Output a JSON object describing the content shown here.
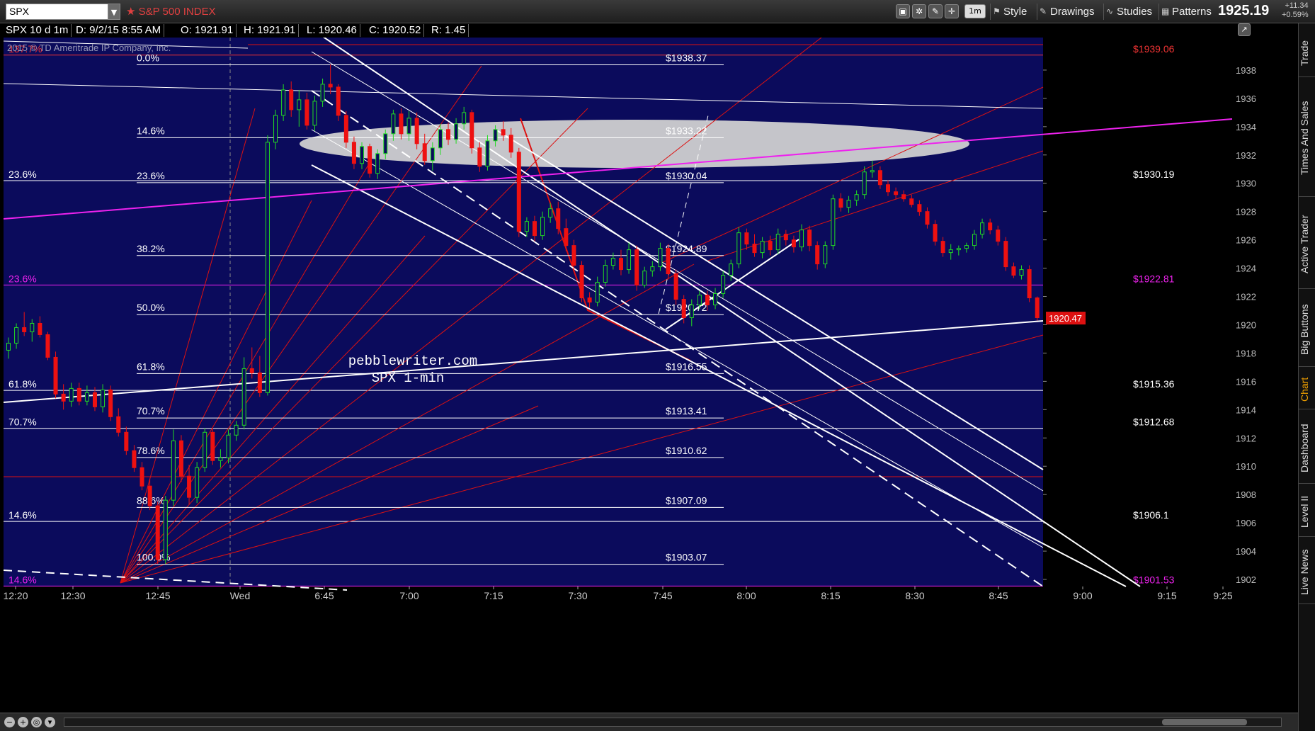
{
  "toolbar": {
    "symbol": "SPX",
    "symbol_name": "S&P 500 INDEX",
    "interval": "1m",
    "buttons": [
      "Style",
      "Drawings",
      "Studies",
      "Patterns"
    ],
    "last_price": "1925.19",
    "net_change": "+11.34",
    "pct_change": "+0.59%"
  },
  "infobar": {
    "cells": [
      "SPX 10 d 1m",
      "D: 9/2/15 8:55 AM",
      "O: 1921.91",
      "H: 1921.91",
      "L: 1920.46",
      "C: 1920.52",
      "R: 1.45"
    ],
    "copyright": "2015 © TD Ameritrade IP Company, Inc."
  },
  "sidebar": {
    "tabs": [
      "Trade",
      "Times And Sales",
      "Active Trader",
      "Big Buttons",
      "Chart",
      "Dashboard",
      "Level II",
      "Live News"
    ],
    "active_tab": "Chart"
  },
  "colors": {
    "background": "#0b0b5c",
    "up_candle": "#22dd22",
    "down_candle": "#ee1111",
    "fib_line": "#ffffff",
    "channel": "#ffffff",
    "magenta": "#ee22ee",
    "red_line": "#dd1111",
    "price_tag": "#dd1111"
  },
  "chart_data": {
    "type": "candlestick",
    "title": "SPX 1-min",
    "watermark": [
      "pebblewriter.com",
      "SPX 1-min"
    ],
    "ylim": [
      1901.5,
      1940.3
    ],
    "y_ticks": [
      1902,
      1904,
      1906,
      1908,
      1910,
      1912,
      1914,
      1916,
      1918,
      1920,
      1922,
      1924,
      1926,
      1928,
      1930,
      1932,
      1934,
      1936,
      1938
    ],
    "x_ticks": [
      "12:20",
      "12:30",
      "12:45",
      "Wed",
      "6:45",
      "7:00",
      "7:15",
      "7:30",
      "7:45",
      "8:00",
      "8:15",
      "8:30",
      "8:45",
      "9:00",
      "9:15",
      "9:25"
    ],
    "current_price_label": "1920.47",
    "fib_retracement": [
      {
        "pct": "0.0%",
        "price": "$1938.37",
        "value": 1938.37
      },
      {
        "pct": "14.6%",
        "price": "$1933.22",
        "value": 1933.22
      },
      {
        "pct": "23.6%",
        "price": "$1930.04",
        "value": 1930.04
      },
      {
        "pct": "38.2%",
        "price": "$1924.89",
        "value": 1924.89
      },
      {
        "pct": "50.0%",
        "price": "$1920.72",
        "value": 1920.72
      },
      {
        "pct": "61.8%",
        "price": "$1916.55",
        "value": 1916.55
      },
      {
        "pct": "70.7%",
        "price": "$1913.41",
        "value": 1913.41
      },
      {
        "pct": "78.6%",
        "price": "$1910.62",
        "value": 1910.62
      },
      {
        "pct": "88.6%",
        "price": "$1907.09",
        "value": 1907.09
      },
      {
        "pct": "100.0%",
        "price": "$1903.07",
        "value": 1903.07
      }
    ],
    "wide_fib_levels": [
      {
        "pct": "137.7%",
        "price": "$1939.06",
        "value": 1939.06,
        "color": "#ee3333"
      },
      {
        "pct": "23.6%",
        "price": "$1930.19",
        "value": 1930.19,
        "color": "#ffffff"
      },
      {
        "pct": "23.6%",
        "price": "$1922.81",
        "value": 1922.81,
        "color": "#ee22ee"
      },
      {
        "pct": "61.8%",
        "price": "$1915.36",
        "value": 1915.36,
        "color": "#ffffff"
      },
      {
        "pct": "70.7%",
        "price": "$1912.68",
        "value": 1912.68,
        "color": "#ffffff"
      },
      {
        "pct": "14.6%",
        "price": "$1906.1",
        "value": 1906.1,
        "color": "#ffffff"
      },
      {
        "pct": "14.6%",
        "price": "$1901.53",
        "value": 1901.53,
        "color": "#ee22ee"
      }
    ],
    "candles": [
      [
        1918.2,
        1919.1,
        1917.6,
        1918.7
      ],
      [
        1918.7,
        1920.1,
        1918.3,
        1919.8
      ],
      [
        1919.8,
        1920.9,
        1919.2,
        1919.5
      ],
      [
        1919.5,
        1920.4,
        1918.8,
        1920.1
      ],
      [
        1920.1,
        1920.6,
        1919.1,
        1919.3
      ],
      [
        1919.3,
        1919.5,
        1917.5,
        1917.7
      ],
      [
        1917.7,
        1918.1,
        1914.8,
        1915.1
      ],
      [
        1915.1,
        1915.8,
        1914.0,
        1914.6
      ],
      [
        1914.6,
        1915.9,
        1914.2,
        1915.5
      ],
      [
        1915.5,
        1915.9,
        1914.3,
        1914.6
      ],
      [
        1914.6,
        1915.7,
        1914.3,
        1915.2
      ],
      [
        1915.2,
        1915.6,
        1913.9,
        1914.2
      ],
      [
        1914.2,
        1915.8,
        1913.8,
        1915.4
      ],
      [
        1915.4,
        1915.7,
        1913.2,
        1913.5
      ],
      [
        1913.5,
        1914.1,
        1912.1,
        1912.4
      ],
      [
        1912.4,
        1912.8,
        1910.8,
        1911.1
      ],
      [
        1911.1,
        1911.5,
        1909.6,
        1909.9
      ],
      [
        1909.9,
        1910.3,
        1908.3,
        1908.6
      ],
      [
        1908.6,
        1909.1,
        1906.9,
        1907.2
      ],
      [
        1907.2,
        1907.5,
        1903.1,
        1903.4
      ],
      [
        1903.4,
        1907.9,
        1903.1,
        1907.6
      ],
      [
        1907.6,
        1912.6,
        1907.2,
        1911.8
      ],
      [
        1911.8,
        1912.2,
        1908.9,
        1909.3
      ],
      [
        1909.3,
        1910.1,
        1907.3,
        1907.8
      ],
      [
        1907.8,
        1910.3,
        1907.4,
        1909.9
      ],
      [
        1909.9,
        1912.7,
        1909.6,
        1912.4
      ],
      [
        1912.4,
        1912.7,
        1910.1,
        1910.4
      ],
      [
        1910.4,
        1911.2,
        1909.9,
        1910.6
      ],
      [
        1910.6,
        1912.6,
        1910.2,
        1912.2
      ],
      [
        1912.2,
        1913.2,
        1911.8,
        1912.9
      ],
      [
        1912.9,
        1917.7,
        1912.6,
        1916.9
      ],
      [
        1916.9,
        1918.4,
        1916.2,
        1916.6
      ],
      [
        1916.6,
        1917.8,
        1914.9,
        1915.2
      ],
      [
        1915.2,
        1933.4,
        1915.0,
        1932.9
      ],
      [
        1932.9,
        1935.2,
        1932.4,
        1934.8
      ],
      [
        1934.8,
        1937.0,
        1934.4,
        1936.6
      ],
      [
        1936.6,
        1937.2,
        1934.7,
        1935.2
      ],
      [
        1935.2,
        1936.6,
        1934.0,
        1935.9
      ],
      [
        1935.9,
        1936.4,
        1933.8,
        1934.1
      ],
      [
        1934.1,
        1936.2,
        1933.7,
        1935.8
      ],
      [
        1935.8,
        1937.4,
        1935.4,
        1937.0
      ],
      [
        1937.0,
        1938.4,
        1936.3,
        1936.8
      ],
      [
        1936.8,
        1937.0,
        1934.4,
        1934.8
      ],
      [
        1934.8,
        1935.1,
        1932.5,
        1932.9
      ],
      [
        1932.9,
        1933.3,
        1931.0,
        1931.4
      ],
      [
        1931.4,
        1932.9,
        1931.0,
        1932.6
      ],
      [
        1932.6,
        1932.8,
        1930.4,
        1930.7
      ],
      [
        1930.7,
        1932.4,
        1930.3,
        1932.1
      ],
      [
        1932.1,
        1933.8,
        1931.7,
        1933.5
      ],
      [
        1933.5,
        1935.2,
        1933.0,
        1934.9
      ],
      [
        1934.9,
        1935.3,
        1933.1,
        1933.5
      ],
      [
        1933.5,
        1935.1,
        1933.0,
        1934.6
      ],
      [
        1934.6,
        1935.0,
        1932.4,
        1932.8
      ],
      [
        1932.8,
        1933.5,
        1931.3,
        1931.6
      ],
      [
        1931.6,
        1932.9,
        1930.9,
        1932.5
      ],
      [
        1932.5,
        1934.2,
        1932.0,
        1933.8
      ],
      [
        1933.8,
        1934.3,
        1932.7,
        1933.1
      ],
      [
        1933.1,
        1934.6,
        1932.8,
        1934.2
      ],
      [
        1934.2,
        1935.4,
        1933.8,
        1935.0
      ],
      [
        1935.0,
        1935.2,
        1932.1,
        1932.5
      ],
      [
        1932.5,
        1932.9,
        1930.8,
        1931.2
      ],
      [
        1931.2,
        1933.4,
        1930.9,
        1933.0
      ],
      [
        1933.0,
        1934.1,
        1932.6,
        1933.8
      ],
      [
        1933.8,
        1934.4,
        1933.0,
        1933.4
      ],
      [
        1933.4,
        1933.9,
        1931.8,
        1932.2
      ],
      [
        1932.2,
        1932.5,
        1926.2,
        1926.6
      ],
      [
        1926.6,
        1927.6,
        1926.2,
        1927.3
      ],
      [
        1927.3,
        1927.7,
        1925.9,
        1926.3
      ],
      [
        1926.3,
        1928.0,
        1926.0,
        1927.6
      ],
      [
        1927.6,
        1928.6,
        1927.2,
        1928.2
      ],
      [
        1928.2,
        1928.7,
        1926.4,
        1926.8
      ],
      [
        1926.8,
        1927.5,
        1925.2,
        1925.6
      ],
      [
        1925.6,
        1926.0,
        1923.8,
        1924.2
      ],
      [
        1924.2,
        1924.5,
        1921.6,
        1921.9
      ],
      [
        1921.9,
        1922.3,
        1921.2,
        1921.6
      ],
      [
        1921.6,
        1923.4,
        1921.3,
        1923.0
      ],
      [
        1923.0,
        1924.6,
        1922.7,
        1924.2
      ],
      [
        1924.2,
        1925.1,
        1923.9,
        1924.7
      ],
      [
        1924.7,
        1925.3,
        1923.5,
        1923.9
      ],
      [
        1923.9,
        1925.8,
        1923.6,
        1925.3
      ],
      [
        1925.3,
        1925.6,
        1922.4,
        1922.8
      ],
      [
        1922.8,
        1924.1,
        1922.6,
        1923.8
      ],
      [
        1923.8,
        1924.5,
        1923.4,
        1924.1
      ],
      [
        1924.1,
        1925.8,
        1923.8,
        1925.4
      ],
      [
        1925.4,
        1925.7,
        1923.2,
        1923.6
      ],
      [
        1923.6,
        1923.9,
        1921.4,
        1921.8
      ],
      [
        1921.8,
        1922.1,
        1920.1,
        1920.5
      ],
      [
        1920.5,
        1921.8,
        1919.9,
        1921.4
      ],
      [
        1921.4,
        1922.4,
        1921.1,
        1922.1
      ],
      [
        1922.1,
        1922.4,
        1921.0,
        1921.4
      ],
      [
        1921.4,
        1922.6,
        1921.1,
        1922.2
      ],
      [
        1922.2,
        1923.8,
        1921.9,
        1923.5
      ],
      [
        1923.5,
        1924.6,
        1923.1,
        1924.3
      ],
      [
        1924.3,
        1926.9,
        1924.0,
        1926.5
      ],
      [
        1926.5,
        1926.8,
        1925.3,
        1925.7
      ],
      [
        1925.7,
        1926.4,
        1924.8,
        1925.1
      ],
      [
        1925.1,
        1926.2,
        1924.7,
        1925.9
      ],
      [
        1925.9,
        1926.3,
        1924.9,
        1925.3
      ],
      [
        1925.3,
        1926.8,
        1925.0,
        1926.4
      ],
      [
        1926.4,
        1926.7,
        1925.6,
        1926.0
      ],
      [
        1926.0,
        1926.3,
        1925.1,
        1925.5
      ],
      [
        1925.5,
        1927.1,
        1925.2,
        1926.7
      ],
      [
        1926.7,
        1927.0,
        1925.2,
        1925.6
      ],
      [
        1925.6,
        1925.9,
        1923.9,
        1924.3
      ],
      [
        1924.3,
        1925.9,
        1924.0,
        1925.6
      ],
      [
        1925.6,
        1929.2,
        1925.3,
        1928.9
      ],
      [
        1928.9,
        1929.3,
        1928.0,
        1928.3
      ],
      [
        1928.3,
        1929.1,
        1927.9,
        1928.8
      ],
      [
        1928.8,
        1929.5,
        1928.4,
        1929.2
      ],
      [
        1929.2,
        1931.2,
        1928.9,
        1930.8
      ],
      [
        1930.8,
        1931.6,
        1930.4,
        1930.9
      ],
      [
        1930.9,
        1931.2,
        1929.6,
        1929.9
      ],
      [
        1929.9,
        1930.2,
        1929.1,
        1929.4
      ],
      [
        1929.4,
        1929.7,
        1928.9,
        1929.2
      ],
      [
        1929.2,
        1929.5,
        1928.7,
        1928.9
      ],
      [
        1928.9,
        1929.2,
        1928.3,
        1928.5
      ],
      [
        1928.5,
        1928.8,
        1927.7,
        1928.0
      ],
      [
        1928.0,
        1928.3,
        1926.8,
        1927.1
      ],
      [
        1927.1,
        1927.4,
        1925.6,
        1925.9
      ],
      [
        1925.9,
        1926.2,
        1924.8,
        1925.1
      ],
      [
        1925.1,
        1925.7,
        1924.6,
        1925.3
      ],
      [
        1925.3,
        1925.6,
        1924.9,
        1925.4
      ],
      [
        1925.4,
        1925.8,
        1925.1,
        1925.6
      ],
      [
        1925.6,
        1926.7,
        1925.3,
        1926.4
      ],
      [
        1926.4,
        1927.5,
        1926.1,
        1927.2
      ],
      [
        1927.2,
        1927.5,
        1926.4,
        1926.7
      ],
      [
        1926.7,
        1927.0,
        1925.6,
        1925.9
      ],
      [
        1925.9,
        1926.2,
        1923.8,
        1924.1
      ],
      [
        1924.1,
        1924.4,
        1923.3,
        1923.5
      ],
      [
        1923.5,
        1924.2,
        1923.2,
        1923.9
      ],
      [
        1923.9,
        1924.2,
        1921.6,
        1921.9
      ],
      [
        1921.9,
        1922.0,
        1920.3,
        1920.5
      ]
    ]
  }
}
